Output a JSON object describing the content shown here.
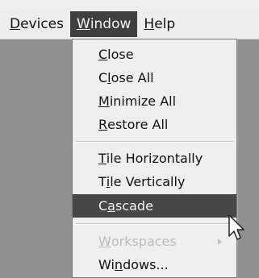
{
  "menubar": {
    "items": [
      {
        "label_u": "D",
        "label_rest": "evices"
      },
      {
        "label_u": "W",
        "label_rest": "indow"
      },
      {
        "label_u": "H",
        "label_rest": "elp"
      }
    ]
  },
  "window_menu": {
    "close": {
      "pre": "",
      "u": "C",
      "post": "lose"
    },
    "close_all": {
      "pre": "C",
      "u": "l",
      "post": "ose All"
    },
    "minimize_all": {
      "pre": "",
      "u": "M",
      "post": "inimize All"
    },
    "restore_all": {
      "pre": "",
      "u": "R",
      "post": "estore All"
    },
    "tile_h": {
      "pre": "",
      "u": "T",
      "post": "ile Horizontally"
    },
    "tile_v": {
      "pre": "T",
      "u": "i",
      "post": "le Vertically"
    },
    "cascade": {
      "pre": "C",
      "u": "a",
      "post": "scade"
    },
    "workspaces": {
      "pre": "",
      "u": "W",
      "post": "orkspaces"
    },
    "windows": {
      "pre": "Wi",
      "u": "n",
      "post": "dows..."
    }
  },
  "icons": {
    "submenu": "chevron-right-icon",
    "cursor": "mouse-pointer-icon"
  },
  "colors": {
    "highlight": "#474747",
    "menu_bg": "#efefef",
    "disabled_text": "#bcbcbc"
  }
}
